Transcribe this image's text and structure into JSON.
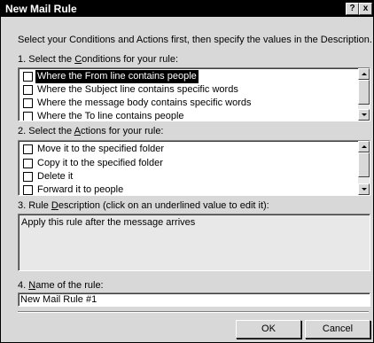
{
  "window": {
    "title": "New Mail Rule",
    "help_glyph": "?",
    "close_glyph": "x"
  },
  "instructions": "Select your Conditions and Actions first, then specify the values in the Description.",
  "conditions": {
    "label_prefix": "1. Select the ",
    "label_key": "C",
    "label_suffix": "onditions for your rule:",
    "items": [
      {
        "label": "Where the From line contains people",
        "selected": true,
        "checked": false
      },
      {
        "label": "Where the Subject line contains specific words",
        "selected": false,
        "checked": false
      },
      {
        "label": "Where the message body contains specific words",
        "selected": false,
        "checked": false
      },
      {
        "label": "Where the To line contains people",
        "selected": false,
        "checked": false
      }
    ]
  },
  "actions": {
    "label_prefix": "2. Select the ",
    "label_key": "A",
    "label_suffix": "ctions for your rule:",
    "items": [
      {
        "label": "Move it to the specified folder",
        "checked": false
      },
      {
        "label": "Copy it to the specified folder",
        "checked": false
      },
      {
        "label": "Delete it",
        "checked": false
      },
      {
        "label": "Forward it to people",
        "checked": false
      }
    ]
  },
  "description": {
    "label_prefix": "3. Rule ",
    "label_key": "D",
    "label_suffix": "escription (click on an underlined value to edit it):",
    "text": "Apply this rule after the message arrives"
  },
  "rule_name": {
    "label_prefix": "4. ",
    "label_key": "N",
    "label_suffix": "ame of the rule:",
    "value": "New Mail Rule #1"
  },
  "buttons": {
    "ok": "OK",
    "cancel": "Cancel"
  }
}
